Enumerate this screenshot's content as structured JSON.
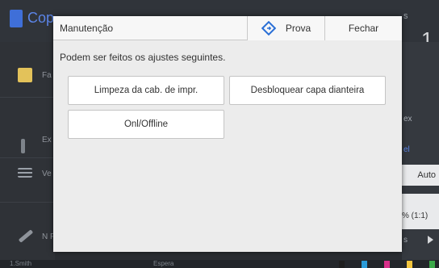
{
  "background": {
    "app_title": "Cop",
    "top_right_text": "s",
    "counter": "1",
    "sidebar_items": [
      {
        "icon": "document-star-icon",
        "label": "Fa"
      },
      {
        "icon": "bar-icon",
        "label": "Ex"
      },
      {
        "icon": "list-icon",
        "label": "Ve de"
      },
      {
        "icon": "wrench-icon",
        "label": "N P"
      }
    ],
    "right_panel": {
      "text1": "ex",
      "text2": "el",
      "auto": "Auto",
      "zoom": "% (1:1)",
      "s_text": "s"
    },
    "status": {
      "user": "1.Smith",
      "state": "Espera",
      "inks": [
        "K",
        "C",
        "M",
        "Y",
        "G"
      ]
    },
    "colors": {
      "accent": "#3f6fd8",
      "yellow": "#f2c53d",
      "cyan": "#2b9bd8",
      "magenta": "#d8308a",
      "green": "#3caa4a"
    }
  },
  "dialog": {
    "title": "Manutenção",
    "prova_label": "Prova",
    "fechar_label": "Fechar",
    "description": "Podem ser feitos os ajustes seguintes.",
    "buttons": {
      "head_cleaning": "Limpeza da cab. de impr.",
      "unlock_front_cover": "Desbloquear capa dianteira",
      "online_offline": "Onl/Offline"
    }
  }
}
